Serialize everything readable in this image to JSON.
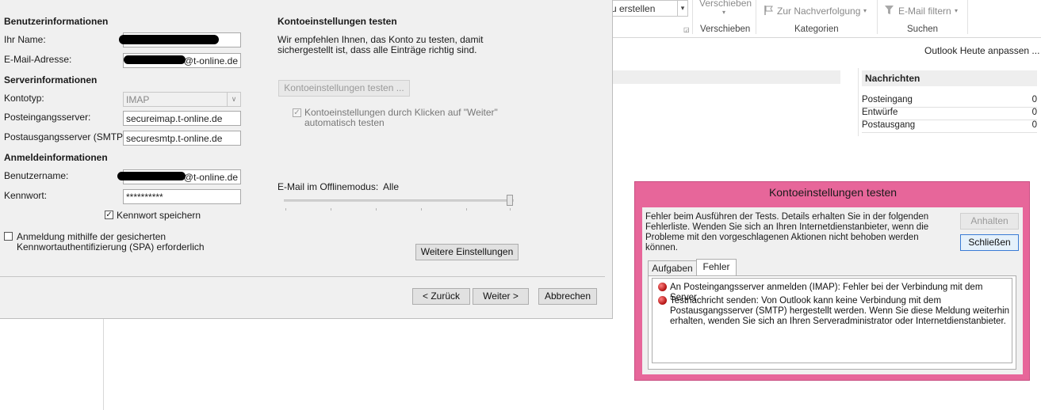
{
  "ribbon": {
    "combo_text": "u erstellen",
    "verschieben_top": "Verschieben",
    "verschieben_group": "Verschieben",
    "nachverfolgung": "Zur Nachverfolgung",
    "kategorien_group": "Kategorien",
    "email_filtern": "E-Mail filtern",
    "suchen_group": "Suchen"
  },
  "outlook": {
    "heute_link": "Outlook Heute anpassen ...",
    "nachrichten": {
      "title": "Nachrichten",
      "rows": [
        {
          "label": "Posteingang",
          "count": "0"
        },
        {
          "label": "Entwürfe",
          "count": "0"
        },
        {
          "label": "Postausgang",
          "count": "0"
        }
      ]
    }
  },
  "account": {
    "user_info_header": "Benutzerinformationen",
    "name_label": "Ihr Name:",
    "name_value": "",
    "email_label": "E-Mail-Adresse:",
    "email_suffix": "@t-online.de",
    "server_info_header": "Serverinformationen",
    "account_type_label": "Kontotyp:",
    "account_type_value": "IMAP",
    "incoming_label": "Posteingangsserver:",
    "incoming_value": "secureimap.t-online.de",
    "outgoing_label": "Postausgangsserver (SMTP):",
    "outgoing_value": "securesmtp.t-online.de",
    "login_info_header": "Anmeldeinformationen",
    "username_label": "Benutzername:",
    "username_suffix": "@t-online.de",
    "password_label": "Kennwort:",
    "password_value": "**********",
    "save_password_label": "Kennwort speichern",
    "spa_label_line1": "Anmeldung mithilfe der gesicherten",
    "spa_label_line2": "Kennwortauthentifizierung (SPA) erforderlich",
    "test_header": "Kontoeinstellungen testen",
    "test_desc_line1": "Wir empfehlen Ihnen, das Konto zu testen, damit",
    "test_desc_line2": "sichergestellt ist, dass alle Einträge richtig sind.",
    "test_button": "Kontoeinstellungen testen ...",
    "auto_test_line1": "Kontoeinstellungen durch Klicken auf \"Weiter\"",
    "auto_test_line2": "automatisch testen",
    "offline_label": "E-Mail im Offlinemodus:",
    "offline_value": "Alle",
    "offline_slider_fraction": 1.0,
    "more_settings_button": "Weitere Einstellungen",
    "back_button": "< Zurück",
    "next_button": "Weiter >",
    "cancel_button": "Abbrechen"
  },
  "test_dialog": {
    "title": "Kontoeinstellungen testen",
    "message_line1": "Fehler beim Ausführen der Tests. Details erhalten Sie in der folgenden",
    "message_line2": "Fehlerliste. Wenden Sie sich an Ihren Internetdienstanbieter, wenn die",
    "message_line3": "Probleme mit den vorgeschlagenen Aktionen nicht behoben werden",
    "message_line4": "können.",
    "stop_button": "Anhalten",
    "close_button": "Schließen",
    "tabs": [
      "Aufgaben",
      "Fehler"
    ],
    "active_tab": "Fehler",
    "errors": [
      {
        "line1": "An Posteingangsserver anmelden (IMAP): Fehler bei der Verbindung mit dem Server."
      },
      {
        "line1": "Testnachricht senden: Von Outlook kann keine Verbindung mit dem",
        "line2": "Postausgangsserver (SMTP) hergestellt werden. Wenn Sie diese Meldung weiterhin",
        "line3": "erhalten, wenden Sie sich an Ihren Serveradministrator oder Internetdienstanbieter."
      }
    ]
  },
  "colors": {
    "test_dialog_frame": "#e7669a",
    "dialog_bg": "#f0f0f0"
  },
  "icons": [
    "flag-icon",
    "filter-icon",
    "error-icon",
    "checkmark-icon",
    "dropdown-arrow-icon"
  ]
}
